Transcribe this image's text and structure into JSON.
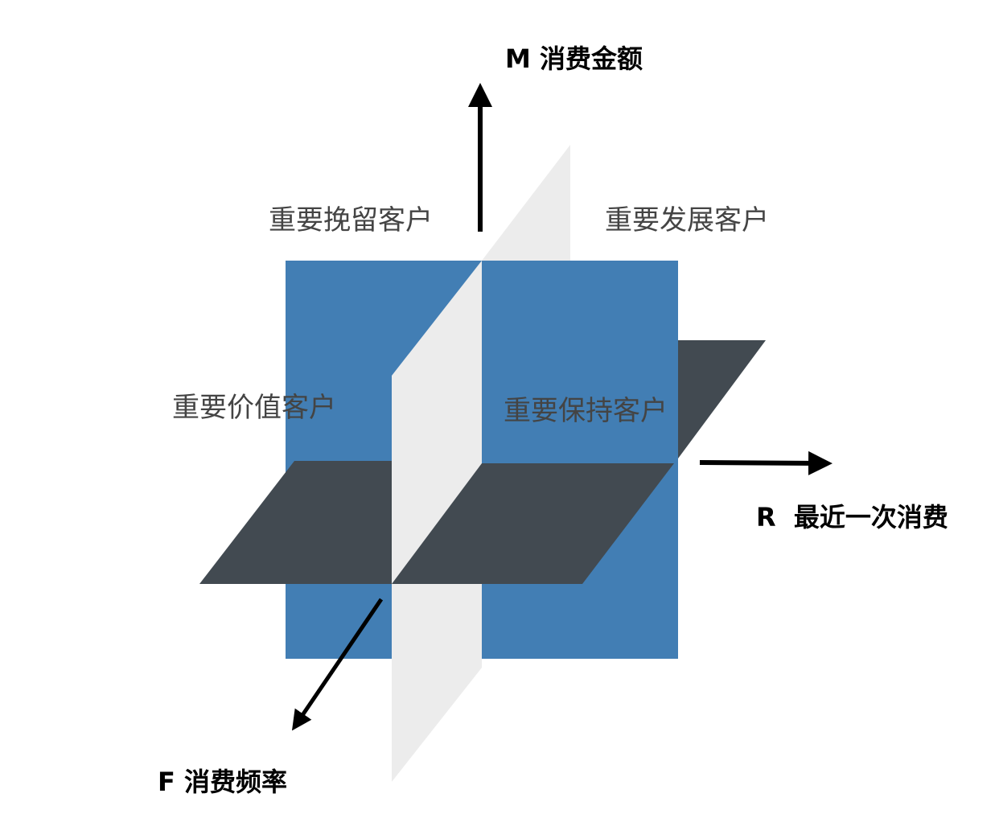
{
  "axes": {
    "m": "M 消费金额",
    "r": "R  最近一次消费",
    "f": "F 消费频率"
  },
  "segments": {
    "retain": "重要挽留客户",
    "develop": "重要发展客户",
    "value": "重要价值客户",
    "keep": "重要保持客户"
  },
  "colors": {
    "vertical_plane": "#427EB4",
    "horizontal_plane": "#424A51",
    "depth_plane": "#ECECEC",
    "arrow": "#000000",
    "label_text": "#444444"
  }
}
